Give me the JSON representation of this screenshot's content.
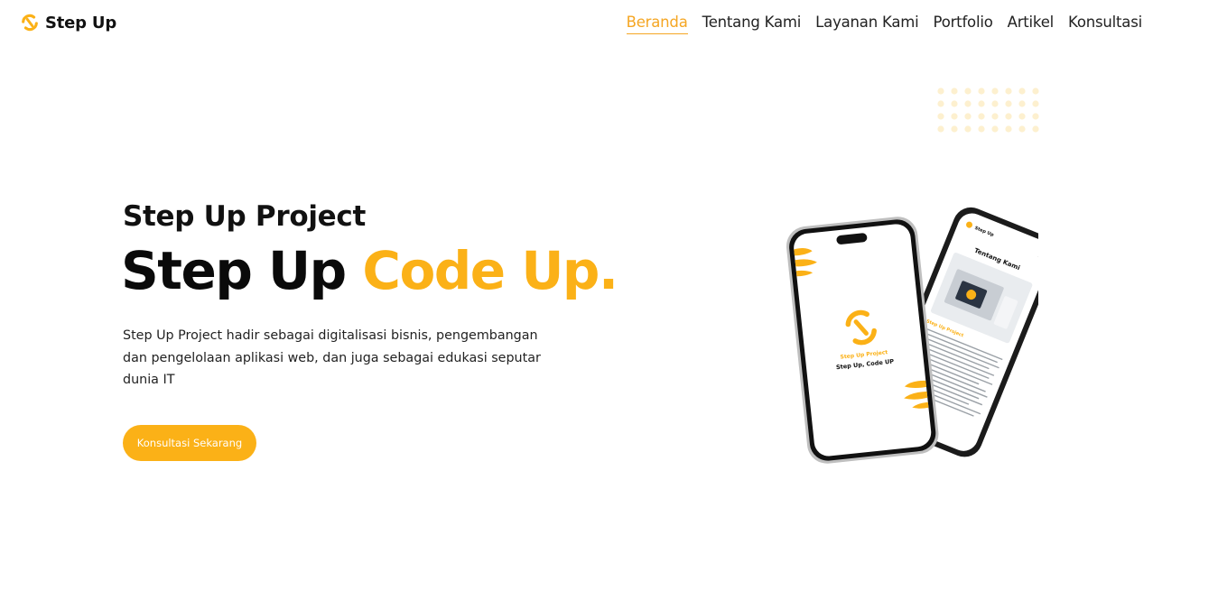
{
  "header": {
    "brand": "Step Up",
    "nav": [
      {
        "label": "Beranda",
        "active": true
      },
      {
        "label": "Tentang Kami",
        "active": false
      },
      {
        "label": "Layanan Kami",
        "active": false
      },
      {
        "label": "Portfolio",
        "active": false
      },
      {
        "label": "Artikel",
        "active": false
      },
      {
        "label": "Konsultasi",
        "active": false
      }
    ]
  },
  "hero": {
    "subtitle": "Step Up Project",
    "title_main": "Step Up",
    "title_accent": "Code Up.",
    "description": "Step Up Project hadir sebagai digitalisasi bisnis, pengembangan dan pengelolaan aplikasi web, dan juga sebagai edukasi seputar dunia IT",
    "cta_label": "Konsultasi Sekarang"
  },
  "phone_mockup": {
    "front_screen_title": "Step Up Project",
    "front_screen_subtitle": "Step Up, Code UP",
    "back_screen_heading": "Tentang Kami",
    "back_screen_brand": "Step Up",
    "back_screen_section": "Step Up Project"
  },
  "colors": {
    "accent": "#fbb117",
    "nav_active": "#f5a623",
    "text": "#111111"
  },
  "icons": {
    "logo": "step-up-logo-icon",
    "menu": "hamburger-menu-icon"
  }
}
